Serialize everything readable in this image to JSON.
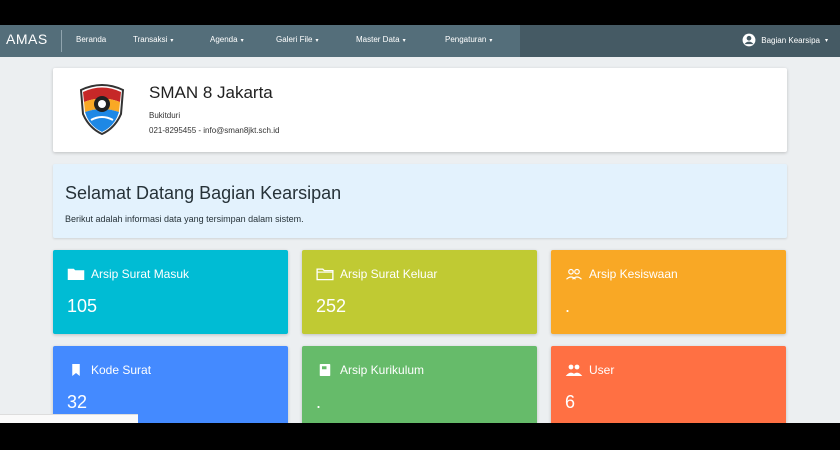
{
  "navbar": {
    "brand": "AMAS",
    "items": [
      {
        "label": "Beranda",
        "dropdown": false
      },
      {
        "label": "Transaksi",
        "dropdown": true
      },
      {
        "label": "Agenda",
        "dropdown": true
      },
      {
        "label": "Galeri File",
        "dropdown": true
      },
      {
        "label": "Master Data",
        "dropdown": true
      },
      {
        "label": "Pengaturan",
        "dropdown": true
      }
    ],
    "user_label": "Bagian Kearsipa",
    "caret": "▾"
  },
  "school": {
    "name": "SMAN 8 Jakarta",
    "address": "Bukitduri",
    "contact": "021-8295455 - info@sman8jkt.sch.id"
  },
  "welcome": {
    "title": "Selamat Datang Bagian Kearsipan",
    "subtitle": "Berikut adalah informasi data yang tersimpan dalam sistem."
  },
  "stats": [
    {
      "label": "Arsip Surat Masuk",
      "value": "105",
      "icon": "folder-icon",
      "color": "#00bcd4"
    },
    {
      "label": "Arsip Surat Keluar",
      "value": "252",
      "icon": "folder-open-icon",
      "color": "#c0ca33"
    },
    {
      "label": "Arsip Kesiswaan",
      "value": ".",
      "icon": "group-icon",
      "color": "#f9a825"
    },
    {
      "label": "Kode Surat",
      "value": "32",
      "icon": "bookmark-icon",
      "color": "#448aff"
    },
    {
      "label": "Arsip Kurikulum",
      "value": ".",
      "icon": "book-icon",
      "color": "#66bb6a"
    },
    {
      "label": "User",
      "value": "6",
      "icon": "people-icon",
      "color": "#ff7043"
    }
  ]
}
